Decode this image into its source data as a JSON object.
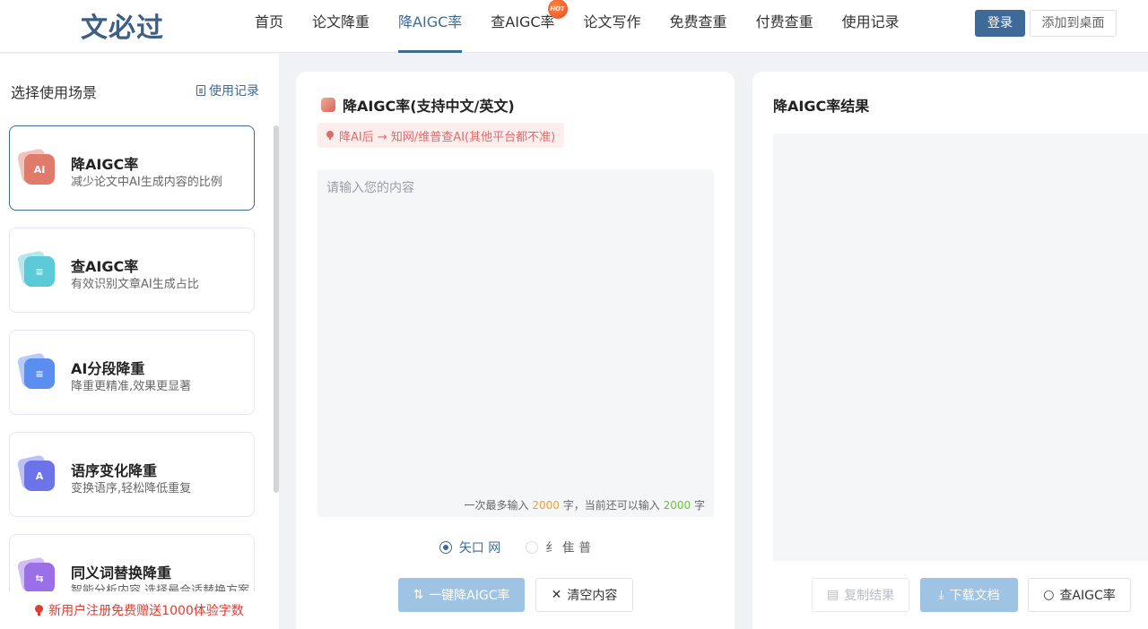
{
  "header": {
    "logo": "文必过",
    "nav": [
      {
        "label": "首页",
        "active": false
      },
      {
        "label": "论文降重",
        "active": false
      },
      {
        "label": "降AIGC率",
        "active": true
      },
      {
        "label": "查AIGC率",
        "active": false,
        "badge": "HOT"
      },
      {
        "label": "论文写作",
        "active": false
      },
      {
        "label": "免费查重",
        "active": false
      },
      {
        "label": "付费查重",
        "active": false
      },
      {
        "label": "使用记录",
        "active": false
      }
    ],
    "login_label": "登录",
    "desktop_label": "添加到桌面"
  },
  "sidebar": {
    "heading": "选择使用场景",
    "records_link": "使用记录",
    "scenes": [
      {
        "title": "降AIGC率",
        "desc": "减少论文中AI生成内容的比例",
        "icon": "reduce-aigc-icon",
        "color": "#e07a6a",
        "glyph": "AI"
      },
      {
        "title": "查AIGC率",
        "desc": "有效识别文章AI生成占比",
        "icon": "check-aigc-icon",
        "color": "#5cc9d6",
        "glyph": "≡"
      },
      {
        "title": "AI分段降重",
        "desc": "降重更精准,效果更显著",
        "icon": "segment-icon",
        "color": "#5b8ef0",
        "glyph": "≡"
      },
      {
        "title": "语序变化降重",
        "desc": "变换语序,轻松降低重复",
        "icon": "word-order-icon",
        "color": "#6c74e8",
        "glyph": "A"
      },
      {
        "title": "同义词替换降重",
        "desc": "智能分析内容,选择最合适替换方案",
        "icon": "synonym-icon",
        "color": "#9b6fe8",
        "glyph": "⇆"
      }
    ],
    "promo": "新用户注册免费赠送1000体验字数"
  },
  "center": {
    "title": "降AIGC率(支持中文/英文)",
    "tip": "降AI后 → 知网/维普查AI(其他平台都不准)",
    "placeholder": "请输入您的内容",
    "counter_prefix": "一次最多输入",
    "counter_max": "2000",
    "counter_mid": "字，当前还可以输入",
    "counter_remaining": "2000",
    "counter_suffix": "字",
    "radio_options": [
      {
        "label": "矢口 网",
        "checked": true
      },
      {
        "label": "纟 隹 普",
        "checked": false
      }
    ],
    "primary_button": "一键降AIGC率",
    "clear_button": "清空内容"
  },
  "right": {
    "title": "降AIGC率结果",
    "copy_button": "复制结果",
    "download_button": "下载文档",
    "check_button": "查AIGC率"
  }
}
